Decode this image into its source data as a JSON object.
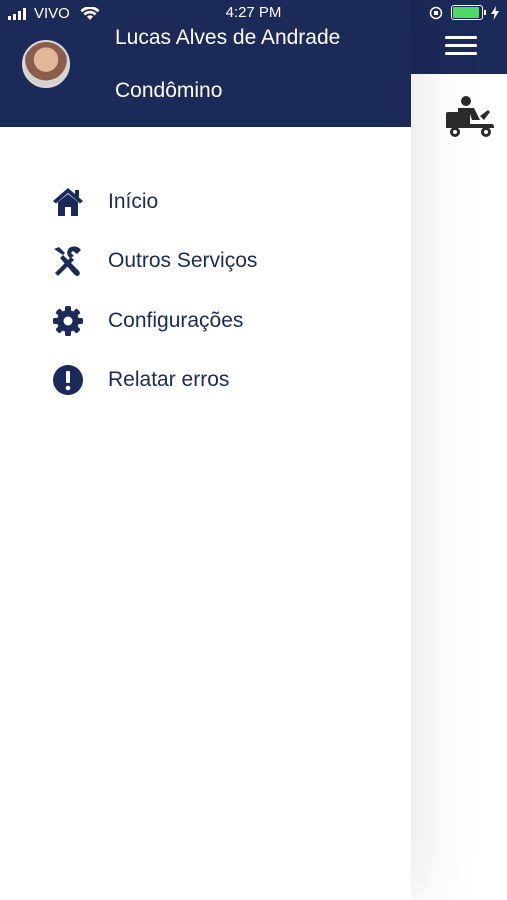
{
  "status_bar": {
    "carrier": "VIVO",
    "time": "4:27 PM"
  },
  "drawer": {
    "user_name": "Lucas Alves de Andrade",
    "user_role": "Condômino",
    "items": [
      {
        "label": "Início",
        "icon": "home-icon"
      },
      {
        "label": "Outros Serviços",
        "icon": "tools-icon"
      },
      {
        "label": "Configurações",
        "icon": "gear-icon"
      },
      {
        "label": "Relatar erros",
        "icon": "alert-icon"
      }
    ]
  },
  "colors": {
    "primary": "#1c2a5a",
    "background": "#ffffff",
    "battery": "#4cd964"
  }
}
